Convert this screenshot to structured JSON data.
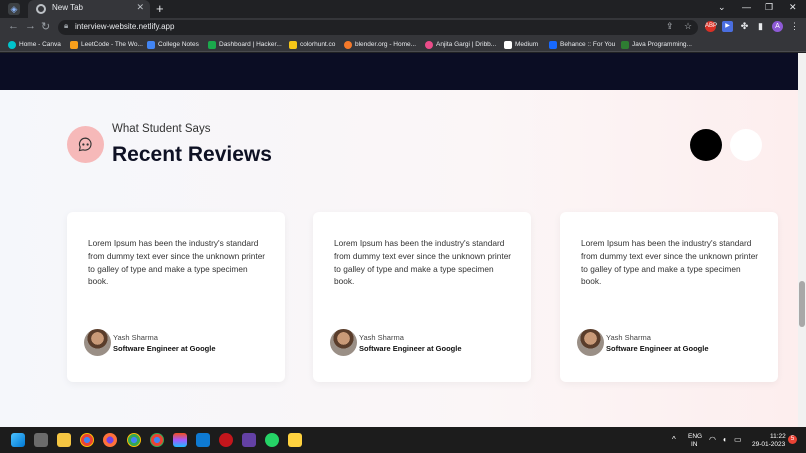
{
  "browser": {
    "tab_title": "New Tab",
    "new_tab_glyph": "+",
    "url": "interview-website.netlify.app",
    "profile_initial": "A",
    "window_controls": [
      "⌄",
      "—",
      "❐",
      "✕"
    ]
  },
  "bookmarks": [
    {
      "label": "Home - Canva",
      "color": "#00c4cc"
    },
    {
      "label": "LeetCode - The Wo...",
      "color": "#f89f1b"
    },
    {
      "label": "College Notes",
      "color": "#4285f4"
    },
    {
      "label": "Dashboard | Hacker...",
      "color": "#1ba94c"
    },
    {
      "label": "colorhunt.co",
      "color": "#f5c518"
    },
    {
      "label": "blender.org - Home...",
      "color": "#f5792a"
    },
    {
      "label": "Anjita Gargi | Dribb...",
      "color": "#ea4c89"
    },
    {
      "label": "Medium",
      "color": "#000000"
    },
    {
      "label": "Behance :: For You",
      "color": "#1769ff"
    },
    {
      "label": "Java Programming...",
      "color": "#2e7d32"
    }
  ],
  "section": {
    "subtitle": "What Student Says",
    "title": "Recent Reviews"
  },
  "reviews": [
    {
      "text": "Lorem Ipsum has been the industry's standard from dummy text ever since the unknown printer to galley of type and make a type specimen book.",
      "name": "Yash Sharma",
      "role": "Software Engineer at Google"
    },
    {
      "text": "Lorem Ipsum has been the industry's standard from dummy text ever since the unknown printer to galley of type and make a type specimen book.",
      "name": "Yash Sharma",
      "role": "Software Engineer at Google"
    },
    {
      "text": "Lorem Ipsum has been the industry's standard from dummy text ever since the unknown printer to galley of type and make a type specimen book.",
      "name": "Yash Sharma",
      "role": "Software Engineer at Google"
    }
  ],
  "taskbar": {
    "lang_top": "ENG",
    "lang_bottom": "IN",
    "time": "11:22",
    "date": "29-01-2023",
    "notifications": "5"
  },
  "colors": {
    "accent_pink": "#f6b9b9",
    "dark_band": "#0b0d24"
  }
}
